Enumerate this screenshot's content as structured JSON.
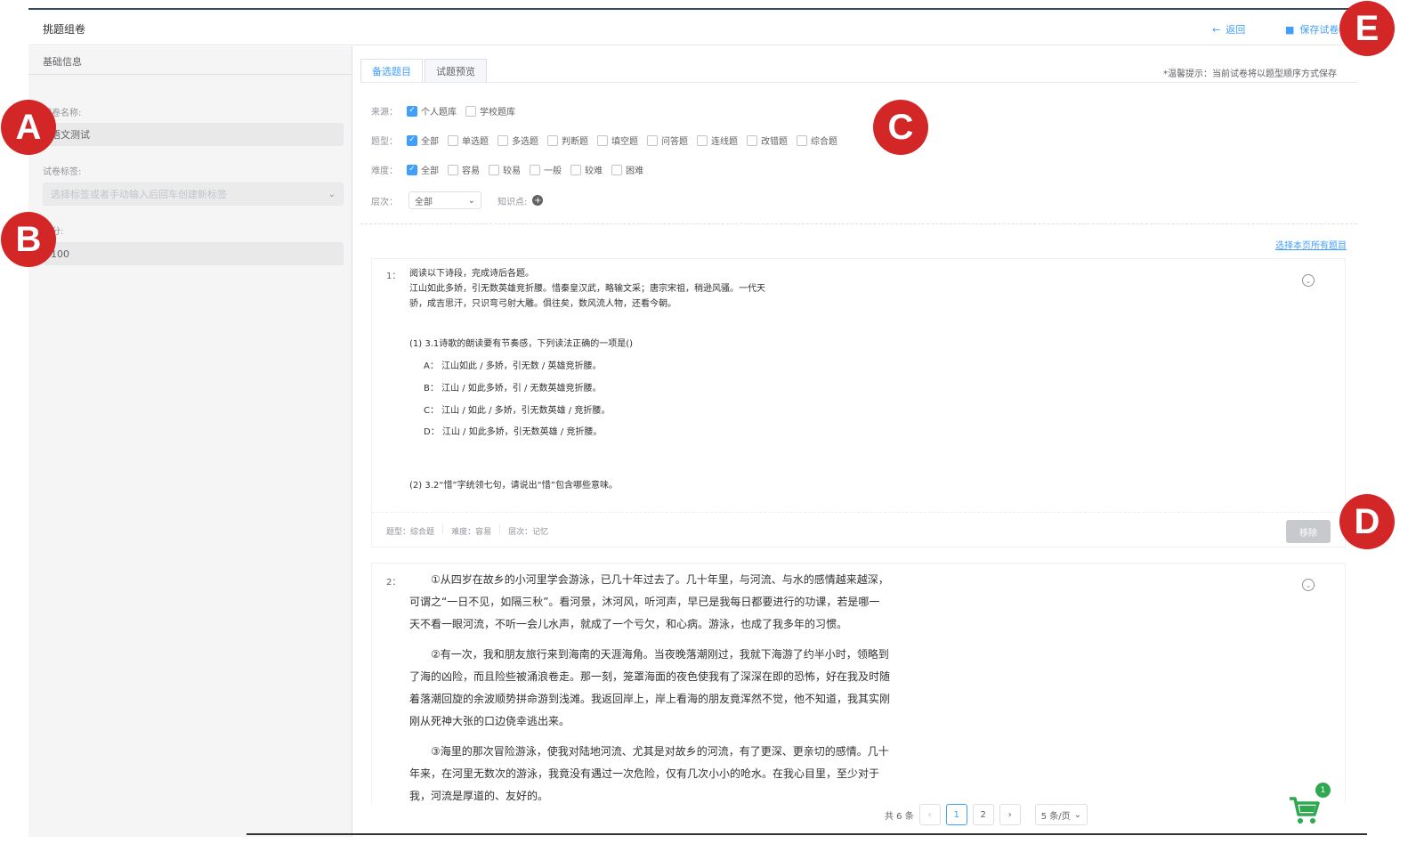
{
  "header": {
    "title": "挑题组卷",
    "back_label": "返回",
    "save_label": "保存试卷"
  },
  "left": {
    "section_title": "基础信息",
    "name_label": "试卷名称:",
    "name_value": "语文测试",
    "tag_label": "试卷标签:",
    "tag_placeholder": "选择标签或者手动输入后回车创建新标签",
    "score_label": "总分:",
    "score_value": "100"
  },
  "tabs": [
    "备选题目",
    "试题预览"
  ],
  "tip": "*温馨提示：当前试卷将以题型顺序方式保存",
  "filters": {
    "source": {
      "label": "来源：",
      "options": [
        {
          "label": "个人题库",
          "checked": true
        },
        {
          "label": "学校题库",
          "checked": false
        }
      ]
    },
    "type": {
      "label": "题型：",
      "options": [
        {
          "label": "全部",
          "checked": true
        },
        {
          "label": "单选题",
          "checked": false
        },
        {
          "label": "多选题",
          "checked": false
        },
        {
          "label": "判断题",
          "checked": false
        },
        {
          "label": "填空题",
          "checked": false
        },
        {
          "label": "问答题",
          "checked": false
        },
        {
          "label": "连线题",
          "checked": false
        },
        {
          "label": "改错题",
          "checked": false
        },
        {
          "label": "综合题",
          "checked": false
        }
      ]
    },
    "difficulty": {
      "label": "难度：",
      "options": [
        {
          "label": "全部",
          "checked": true
        },
        {
          "label": "容易",
          "checked": false
        },
        {
          "label": "较易",
          "checked": false
        },
        {
          "label": "一般",
          "checked": false
        },
        {
          "label": "较难",
          "checked": false
        },
        {
          "label": "困难",
          "checked": false
        }
      ]
    },
    "level": {
      "label": "层次：",
      "value": "全部"
    },
    "knowledge_label": "知识点:"
  },
  "select_all": "选择本页所有题目",
  "q1": {
    "num": "1：",
    "stem": [
      "阅读以下诗段，完成诗后各题。",
      "江山如此多娇，引无数英雄竞折腰。惜秦皇汉武，略输文采；唐宗宋祖，稍逊风骚。一代天",
      "骄，成吉思汗，只识弯弓射大雕。俱往矣，数风流人物，还看今朝。"
    ],
    "sub1": "(1)  3.1诗歌的朗读要有节奏感，下列读法正确的一项是()",
    "options": [
      "A：  江山如此 / 多娇，引无数 / 英雄竞折腰。",
      "B：  江山 / 如此多娇，引 / 无数英雄竞折腰。",
      "C：  江山 / 如此 / 多娇，引无数英雄 / 竞折腰。",
      "D：  江山 / 如此多娇，引无数英雄 / 竞折腰。"
    ],
    "sub2": "(2)  3.2“惜”字统领七句，请说出“惜”包含哪些意味。",
    "meta": [
      "题型：综合题",
      "难度：容易",
      "层次：记忆"
    ],
    "remove_label": "移除"
  },
  "q2": {
    "num": "2：",
    "paragraphs": [
      [
        "①从四岁在故乡的小河里学会游泳，已几十年过去了。几十年里，与河流、与水的感情越来越深，",
        "可谓之“一日不见，如隔三秋”。看河景，沐河风，听河声，早已是我每日都要进行的功课，若是哪一",
        "天不看一眼河流，不听一会儿水声，就成了一个亏欠，和心病。游泳，也成了我多年的习惯。"
      ],
      [
        "②有一次，我和朋友旅行来到海南的天涯海角。当夜晚落潮刚过，我就下海游了约半小时，领略到",
        "了海的凶险，而且险些被涌浪卷走。那一刻，笼罩海面的夜色使我有了深深在即的恐怖，好在我及时随",
        "着落潮回旋的余波顺势拼命游到浅滩。我返回岸上，岸上看海的朋友竟浑然不觉，他不知道，我其实刚",
        "刚从死神大张的口边侥幸逃出来。"
      ],
      [
        "③海里的那次冒险游泳，使我对陆地河流、尤其是对故乡的河流，有了更深、更亲切的感情。几十",
        "年来，在河里无数次的游泳，我竟没有遇过一次危险，仅有几次小小的呛水。在我心目里，至少对于",
        "我，河流是厚道的、友好的。"
      ]
    ]
  },
  "pagination": {
    "total": "共 6 条",
    "pages": [
      "1",
      "2"
    ],
    "prev": "‹",
    "next": "›",
    "size": "5 条/页"
  },
  "cart": {
    "badge": "1"
  },
  "markers": [
    "A",
    "B",
    "C",
    "D",
    "E"
  ]
}
